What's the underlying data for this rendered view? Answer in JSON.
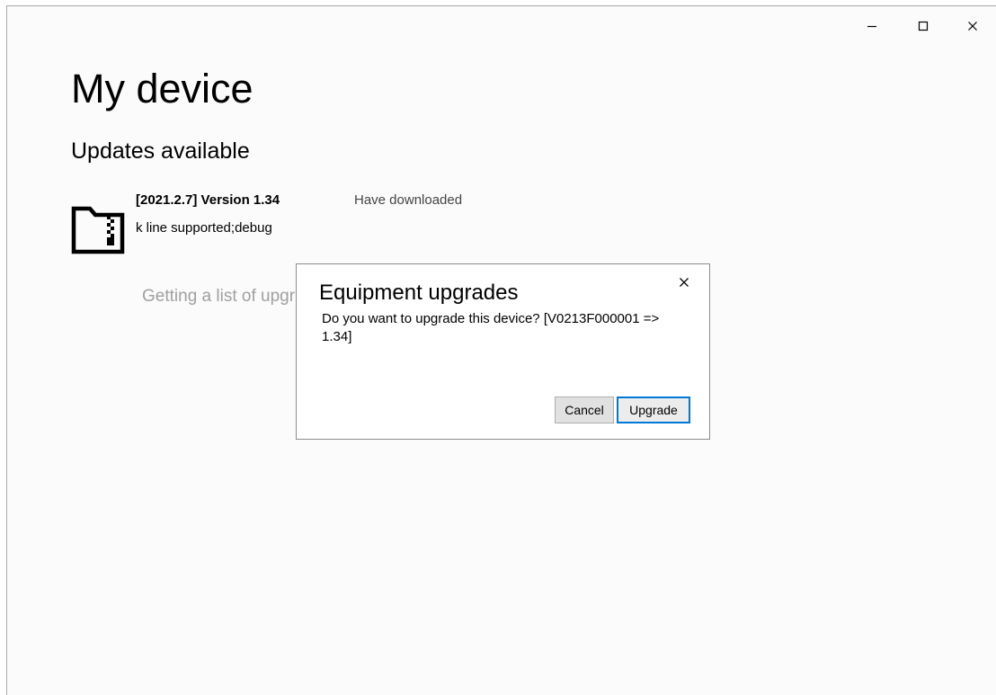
{
  "window": {
    "minimize_icon": "minimize-icon",
    "maximize_icon": "maximize-icon",
    "close_icon": "close-icon"
  },
  "page": {
    "title": "My device",
    "section_title": "Updates available",
    "updates": [
      {
        "icon": "zip-folder-icon",
        "version_title": "[2021.2.7] Version 1.34",
        "status": "Have downloaded",
        "description": "k line supported;debug"
      }
    ],
    "loading_text": "Getting a list of upgr"
  },
  "dialog": {
    "title": "Equipment upgrades",
    "close_icon": "close-icon",
    "message_lines": [
      "Do you want to upgrade this device? [V0213F000001 =>",
      "1.34]"
    ],
    "buttons": {
      "cancel": "Cancel",
      "confirm": "Upgrade"
    }
  },
  "colors": {
    "window_background": "#fbfbfb",
    "frame_border": "#a8a8a8",
    "status_text": "#444444",
    "loading_text": "#a0a0a0",
    "dialog_border": "#8c8c8c",
    "button_background": "#e1e1e1",
    "focus_accent": "#0078d7"
  }
}
